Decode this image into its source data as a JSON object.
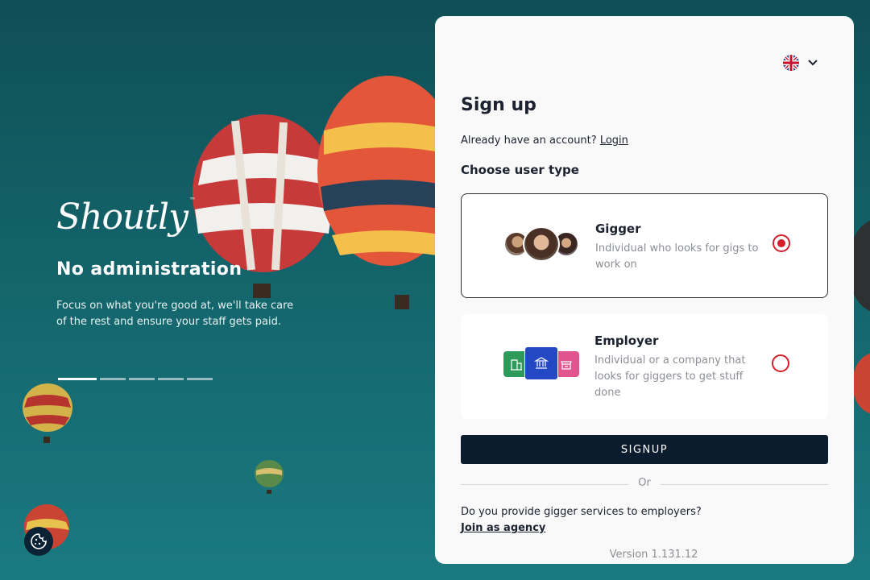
{
  "hero": {
    "logo": "Shoutly",
    "logo_tm": "™",
    "slide_title": "No administration",
    "slide_text": "Focus on what you're good at, we'll take care of the rest and ensure your staff gets paid.",
    "slides_total": 5,
    "active_slide": 1
  },
  "panel": {
    "language_icon": "uk-flag-icon",
    "title": "Sign up",
    "already_text": "Already have an account?",
    "login_link": "Login",
    "choose_label": "Choose user type",
    "user_types": [
      {
        "name": "Gigger",
        "description": "Individual who looks for gigs to work on",
        "selected": true
      },
      {
        "name": "Employer",
        "description": "Individual or a company that looks for giggers to get stuff done",
        "selected": false
      }
    ],
    "signup_button": "SIGNUP",
    "or_text": "Or",
    "agency_question": "Do you provide gigger services to employers?",
    "agency_link": "Join as agency",
    "version": "Version 1.131.12"
  },
  "colors": {
    "accent_red": "#d11f2b",
    "button_dark": "#0b1c2e",
    "tile_green": "#2e9a5a",
    "tile_blue": "#2447c4",
    "tile_pink": "#e0558e"
  }
}
